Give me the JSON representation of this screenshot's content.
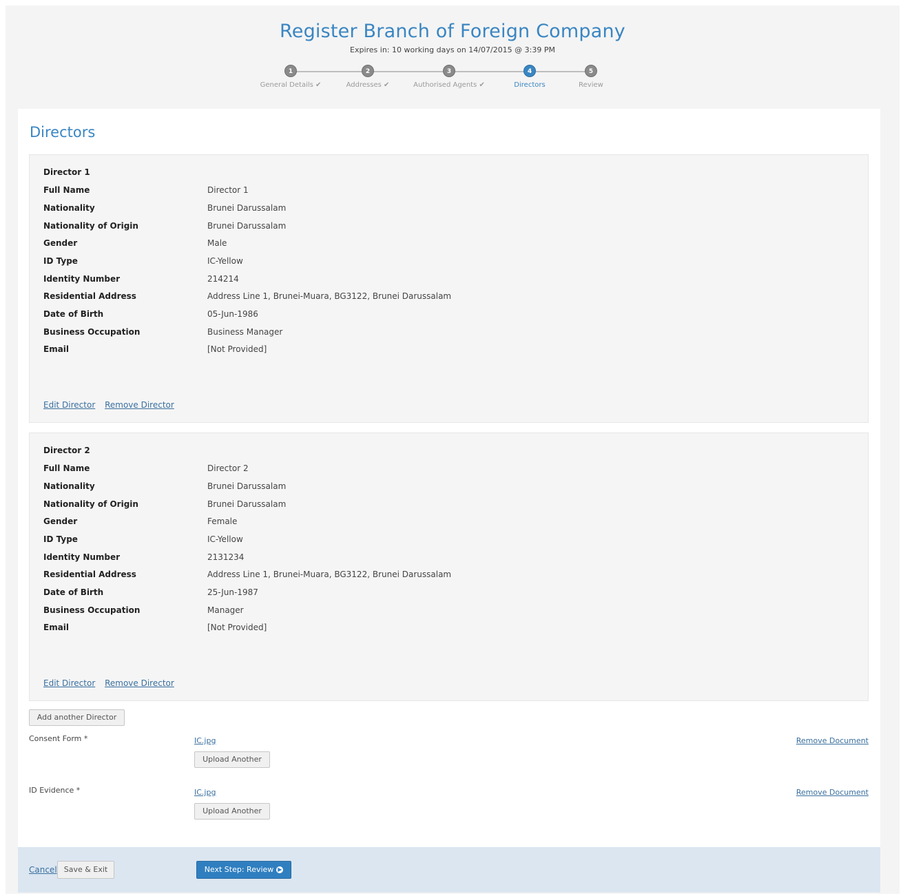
{
  "header": {
    "title": "Register Branch of Foreign Company",
    "expiry": "Expires in: 10 working days on 14/07/2015 @ 3:39 PM"
  },
  "stepper": [
    {
      "num": "1",
      "label": "General Details ✔",
      "active": false
    },
    {
      "num": "2",
      "label": "Addresses ✔",
      "active": false
    },
    {
      "num": "3",
      "label": "Authorised Agents ✔",
      "active": false
    },
    {
      "num": "4",
      "label": "Directors",
      "active": true
    },
    {
      "num": "5",
      "label": "Review",
      "active": false
    }
  ],
  "section_title": "Directors",
  "field_labels": {
    "full_name": "Full Name",
    "nationality": "Nationality",
    "nationality_origin": "Nationality of Origin",
    "gender": "Gender",
    "id_type": "ID Type",
    "identity_number": "Identity Number",
    "residential_address": "Residential Address",
    "dob": "Date of Birth",
    "occupation": "Business Occupation",
    "email": "Email"
  },
  "directors": [
    {
      "title": "Director 1",
      "full_name": "Director 1",
      "nationality": "Brunei Darussalam",
      "nationality_origin": "Brunei Darussalam",
      "gender": "Male",
      "id_type": "IC-Yellow",
      "identity_number": "214214",
      "residential_address": "Address Line 1, Brunei-Muara, BG3122, Brunei Darussalam",
      "dob": "05-Jun-1986",
      "occupation": "Business Manager",
      "email": "[Not Provided]",
      "edit_label": "Edit Director",
      "remove_label": "Remove Director"
    },
    {
      "title": "Director 2",
      "full_name": "Director 2",
      "nationality": "Brunei Darussalam",
      "nationality_origin": "Brunei Darussalam",
      "gender": "Female",
      "id_type": "IC-Yellow",
      "identity_number": "2131234",
      "residential_address": "Address Line 1, Brunei-Muara, BG3122, Brunei Darussalam",
      "dob": "25-Jun-1987",
      "occupation": "Manager",
      "email": "[Not Provided]",
      "edit_label": "Edit Director",
      "remove_label": "Remove Director"
    }
  ],
  "add_director_label": "Add another Director",
  "documents": [
    {
      "label": "Consent Form *",
      "file": "IC.jpg",
      "upload_label": "Upload Another",
      "remove_label": "Remove Document"
    },
    {
      "label": "ID Evidence *",
      "file": "IC.jpg",
      "upload_label": "Upload Another",
      "remove_label": "Remove Document"
    }
  ],
  "footer": {
    "cancel_label": "Cancel",
    "save_exit_label": "Save & Exit",
    "next_label": "Next Step: Review"
  },
  "colors": {
    "accent": "#3a86c2",
    "footer_bg": "#dbe6f1",
    "primary_button": "#2f7fc0"
  }
}
